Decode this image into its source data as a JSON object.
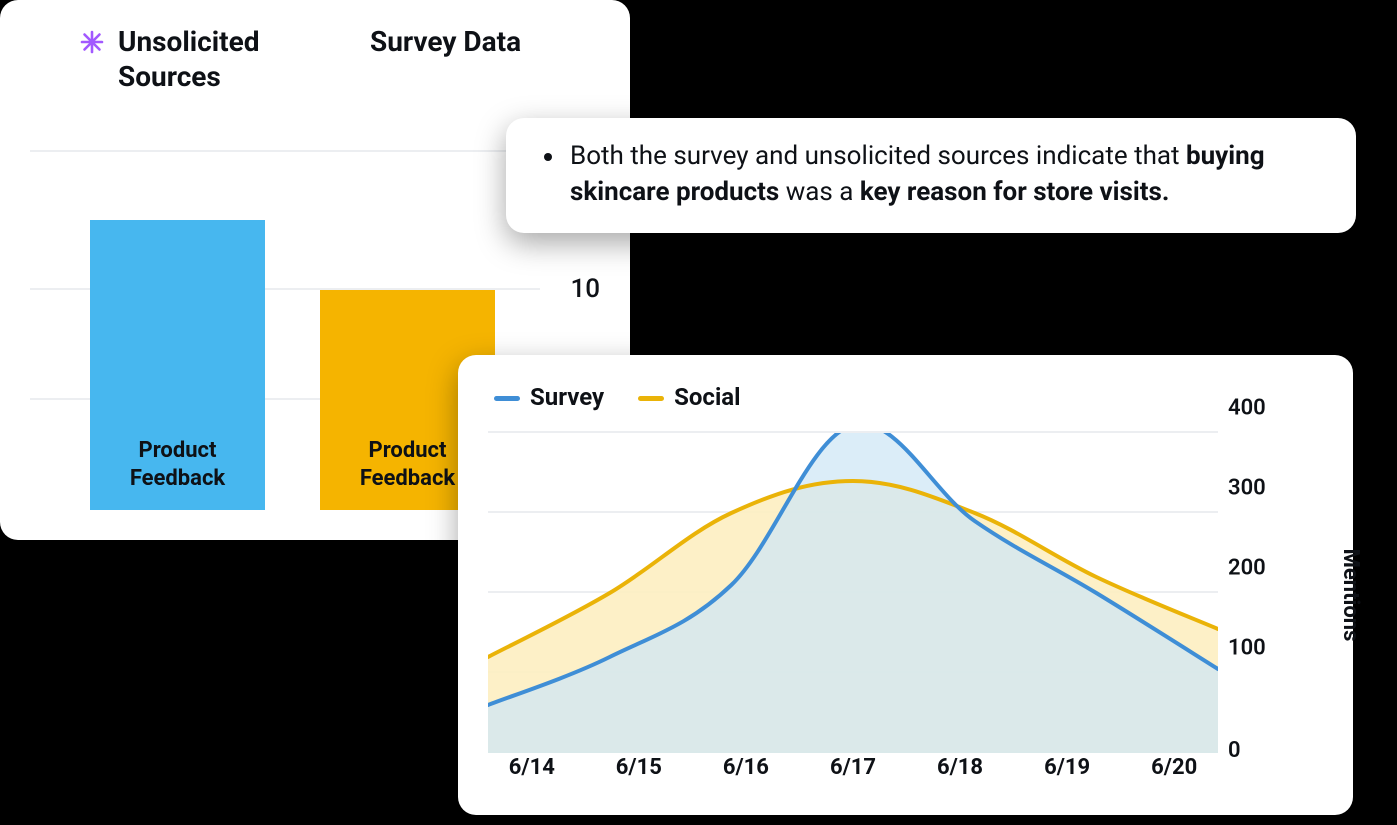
{
  "bar_card": {
    "legend": {
      "unsolicited": "Unsolicited Sources",
      "survey": "Survey Data"
    },
    "bar_labels": {
      "bar1": "Product Feedback",
      "bar2": "Product Feedback"
    },
    "y_tick": "10",
    "colors": {
      "unsolicited": "#47b7ef",
      "survey": "#f5b400",
      "asterisk": "#a259ff"
    }
  },
  "insight_card": {
    "prefix": "Both the survey and unsolicited sources indicate that ",
    "bold1": "buying skincare products",
    "mid": " was a ",
    "bold2": "key reason for store visits."
  },
  "area_card": {
    "legend": {
      "survey": "Survey",
      "social": "Social"
    },
    "colors": {
      "survey_line": "#3f8ed6",
      "survey_fill": "#cfe7f6",
      "social_line": "#eab308",
      "social_fill": "#fdeec1"
    },
    "y_label": "Mentions",
    "x_ticks": [
      "6/14",
      "6/15",
      "6/16",
      "6/17",
      "6/18",
      "6/19",
      "6/20"
    ],
    "y_ticks": [
      "0",
      "100",
      "200",
      "300",
      "400"
    ]
  },
  "chart_data": [
    {
      "type": "bar",
      "title": "",
      "categories": [
        "Unsolicited Sources",
        "Survey Data"
      ],
      "values": [
        13,
        10
      ],
      "bar_labels": [
        "Product Feedback",
        "Product Feedback"
      ],
      "xlabel": "",
      "ylabel": "",
      "y_ticks": [
        10
      ]
    },
    {
      "type": "area",
      "title": "",
      "xlabel": "",
      "ylabel": "Mentions",
      "x": [
        "6/14",
        "6/15",
        "6/16",
        "6/17",
        "6/18",
        "6/19",
        "6/20"
      ],
      "ylim": [
        0,
        400
      ],
      "series": [
        {
          "name": "Survey",
          "values": [
            60,
            120,
            210,
            410,
            290,
            200,
            105
          ]
        },
        {
          "name": "Social",
          "values": [
            120,
            200,
            300,
            340,
            300,
            220,
            155
          ]
        }
      ]
    }
  ]
}
